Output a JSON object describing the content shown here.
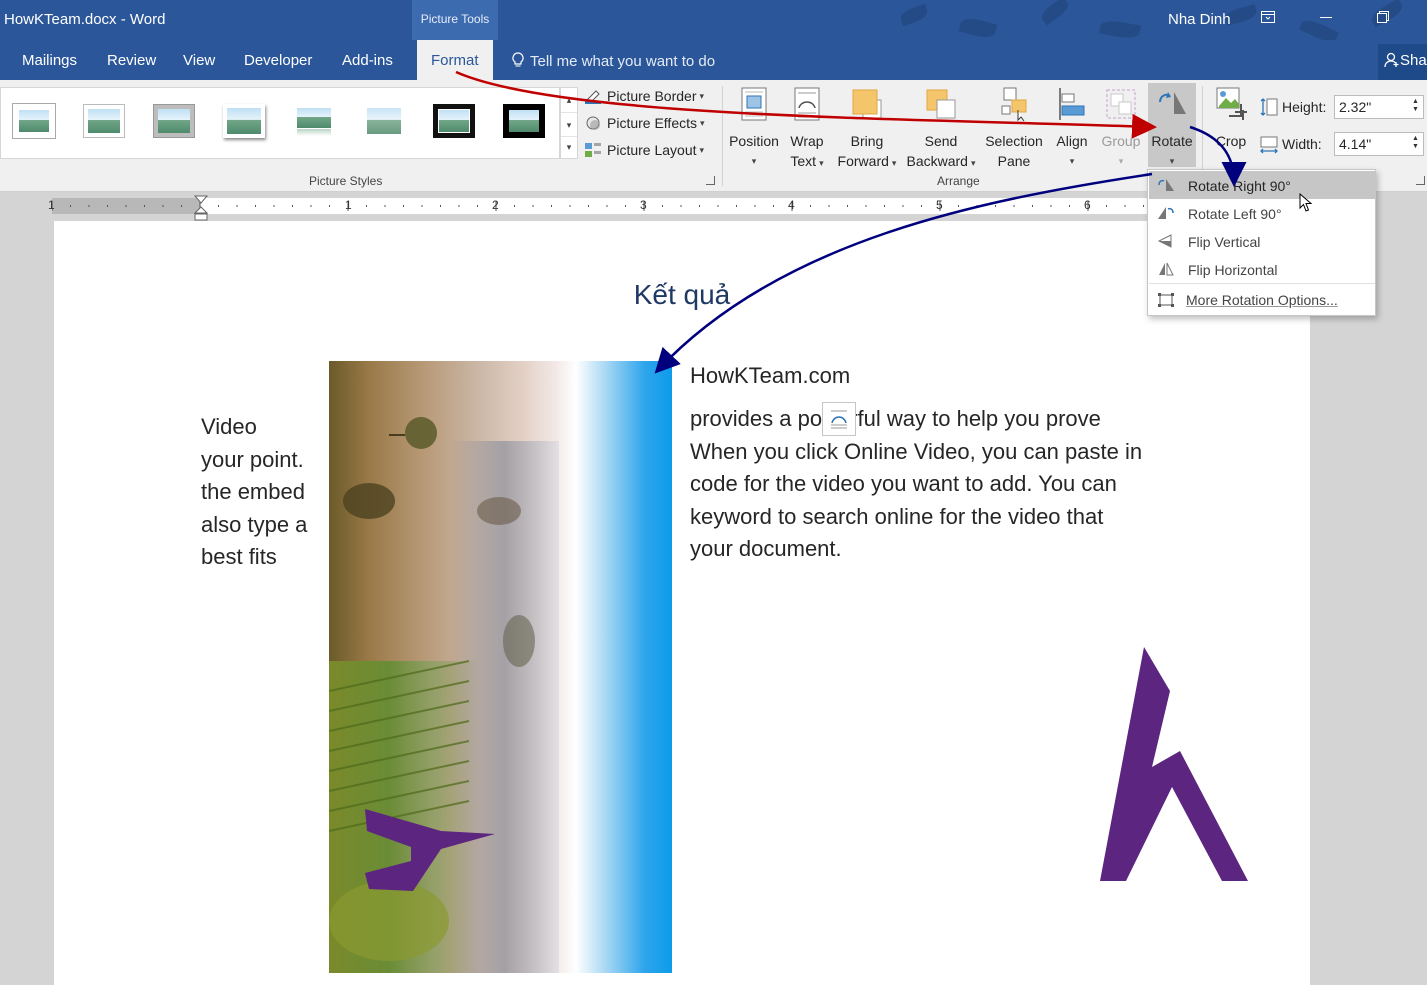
{
  "titlebar": {
    "doc_title": "HowKTeam.docx - Word",
    "context_tab": "Picture Tools",
    "user": "Nha Dinh",
    "ribbon_options_icon": "ribbon-display-options-icon",
    "minimize_icon": "minimize-icon",
    "restore_icon": "restore-icon"
  },
  "tabs": {
    "mailings": "Mailings",
    "review": "Review",
    "view": "View",
    "developer": "Developer",
    "addins": "Add-ins",
    "format": "Format",
    "tell_me": "Tell me what you want to do",
    "share": "Sha"
  },
  "ribbon": {
    "picture_styles_label": "Picture Styles",
    "picture_border": "Picture Border",
    "picture_effects": "Picture Effects",
    "picture_layout": "Picture Layout",
    "arrange_label": "Arrange",
    "position": "Position",
    "wrap_text_1": "Wrap",
    "wrap_text_2": "Text",
    "bring_forward_1": "Bring",
    "bring_forward_2": "Forward",
    "send_backward_1": "Send",
    "send_backward_2": "Backward",
    "selection_pane_1": "Selection",
    "selection_pane_2": "Pane",
    "align": "Align",
    "group": "Group",
    "rotate": "Rotate",
    "crop": "Crop",
    "height_label": "Height:",
    "height_value": "2.32\"",
    "width_label": "Width:",
    "width_value": "4.14\""
  },
  "ruler": {
    "numbers": [
      "1",
      "1",
      "2",
      "3",
      "4",
      "5",
      "6"
    ]
  },
  "rotate_menu": {
    "rotate_right": "Rotate Right 90°",
    "rotate_left": "Rotate Left 90°",
    "flip_vertical": "Flip Vertical",
    "flip_horizontal": "Flip Horizontal",
    "more_options": "More Rotation Options..."
  },
  "document": {
    "heading": "Kết quả",
    "left_lines": [
      "Video",
      "your point.",
      "the embed",
      "also type a",
      "best fits"
    ],
    "site": "HowKTeam.com",
    "right_lines": [
      "provides a powerful way to help you prove",
      "When you click Online Video, you can paste in",
      "code for the video you want to add. You can",
      "keyword to search online for the video that",
      "your document."
    ]
  },
  "colors": {
    "word_blue": "#2b579a",
    "arrow_red": "#c00000",
    "arrow_blue": "#00007f",
    "logo_purple": "#5b2580"
  }
}
